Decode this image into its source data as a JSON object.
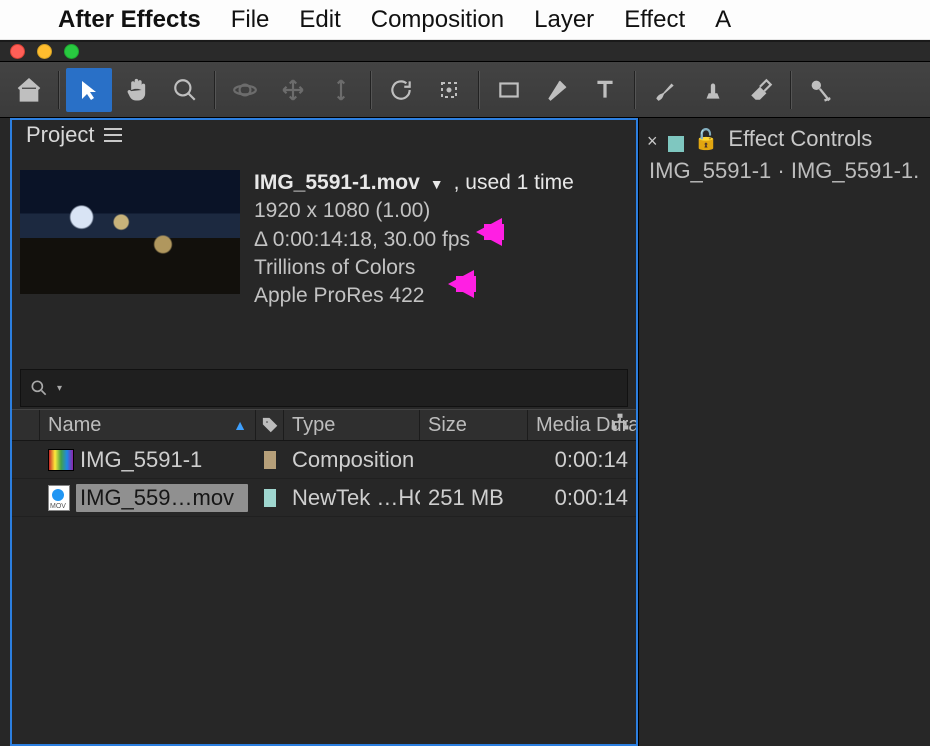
{
  "menubar": {
    "app_name": "After Effects",
    "items": [
      "File",
      "Edit",
      "Composition",
      "Layer",
      "Effect",
      "A"
    ]
  },
  "panel": {
    "title": "Project"
  },
  "asset": {
    "name": "IMG_5591-1.mov",
    "used": ", used 1 time",
    "dims": "1920 x 1080 (1.00)",
    "time_fps": "Δ 0:00:14:18, 30.00 fps",
    "colors": "Trillions of Colors",
    "codec": "Apple ProRes 422"
  },
  "search": {
    "placeholder": ""
  },
  "columns": {
    "name": "Name",
    "type": "Type",
    "size": "Size",
    "duration": "Media Durati"
  },
  "rows": [
    {
      "name": "IMG_5591-1",
      "kind": "comp",
      "swatch": "#b7a07a",
      "type": "Composition",
      "size": "",
      "duration": "0:00:14",
      "selected": false
    },
    {
      "name": "IMG_559…mov",
      "kind": "mov",
      "swatch": "#9fd6cf",
      "type": "NewTek …HQ",
      "size": "251 MB",
      "duration": "0:00:14",
      "selected": true
    }
  ],
  "effect_controls": {
    "title": "Effect Controls",
    "path": "IMG_5591-1 · IMG_5591-1."
  }
}
